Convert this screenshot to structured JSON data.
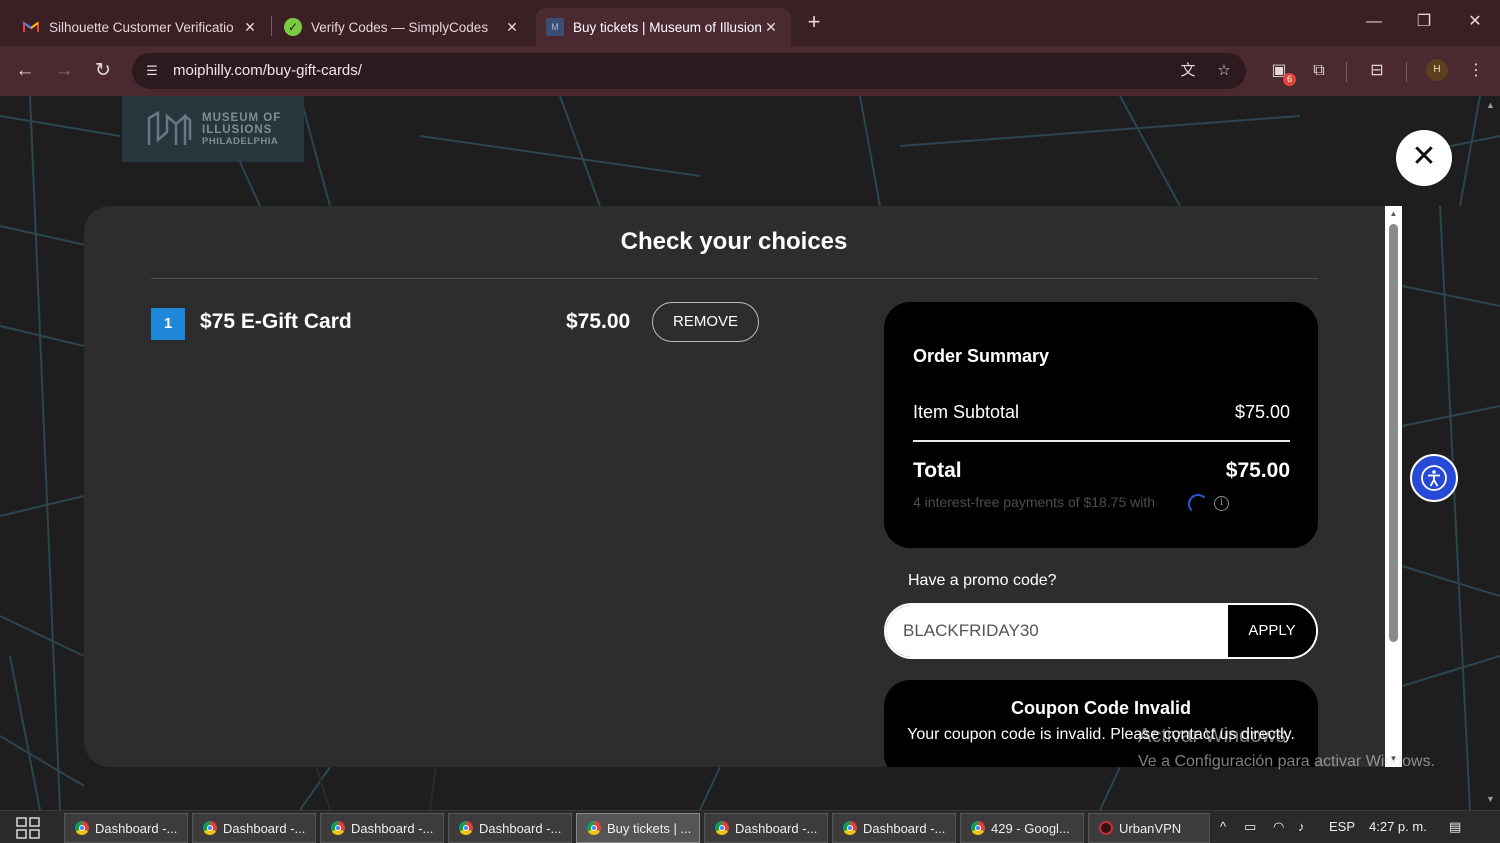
{
  "browser": {
    "tabs": [
      {
        "title": "Silhouette Customer Verificatio",
        "icon": "gmail-icon",
        "active": false
      },
      {
        "title": "Verify Codes — SimplyCodes",
        "icon": "simplycodes-icon",
        "active": false
      },
      {
        "title": "Buy tickets | Museum of Illusion",
        "icon": "museum-icon",
        "active": true
      }
    ],
    "url": "moiphilly.com/buy-gift-cards/",
    "extensions_badge": "6",
    "profile_initial": "H"
  },
  "site": {
    "logo_lines": [
      "MUSEUM OF",
      "ILLUSIONS",
      "PHILADELPHIA"
    ]
  },
  "modal": {
    "title": "Check your choices",
    "item": {
      "quantity": "1",
      "name": "$75 E-Gift Card",
      "price": "$75.00",
      "remove_label": "REMOVE"
    },
    "summary": {
      "title": "Order Summary",
      "subtotal_label": "Item Subtotal",
      "subtotal_value": "$75.00",
      "total_label": "Total",
      "total_value": "$75.00",
      "installments_text": "4 interest-free payments of $18.75 with"
    },
    "promo": {
      "label": "Have a promo code?",
      "value": "BLACKFRIDAY30",
      "apply_label": "APPLY"
    },
    "error": {
      "title": "Coupon Code Invalid",
      "message": "Your coupon code is invalid. Please contact us directly."
    }
  },
  "watermark": {
    "line1": "Activar Windows",
    "line2": "Ve a Configuración para activar Windows."
  },
  "taskbar": {
    "items": [
      {
        "label": "Dashboard -...",
        "active": false
      },
      {
        "label": "Dashboard -...",
        "active": false
      },
      {
        "label": "Dashboard -...",
        "active": false
      },
      {
        "label": "Dashboard -...",
        "active": false
      },
      {
        "label": "Buy tickets | ...",
        "active": true
      },
      {
        "label": "Dashboard -...",
        "active": false
      },
      {
        "label": "Dashboard -...",
        "active": false
      },
      {
        "label": "429 - Googl...",
        "active": false
      },
      {
        "label": "UrbanVPN",
        "active": false
      }
    ],
    "language": "ESP",
    "time": "4:27 p. m."
  },
  "colors": {
    "accent_blue": "#1f87d8",
    "accessibility_blue": "#2749d6",
    "chrome_bg": "#4a2a30"
  }
}
